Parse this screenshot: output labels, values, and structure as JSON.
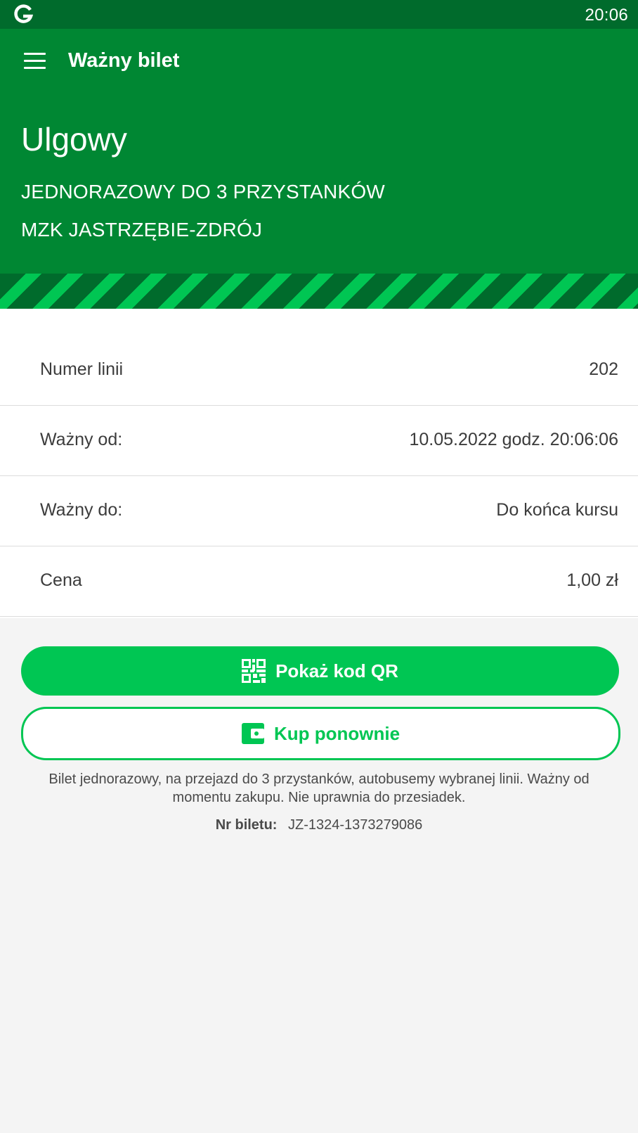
{
  "status_bar": {
    "app_icon": "google-g-icon",
    "time": "20:06"
  },
  "app_bar": {
    "menu_icon": "hamburger-menu-icon",
    "title": "Ważny bilet"
  },
  "ticket": {
    "type": "Ulgowy",
    "name": "JEDNORAZOWY DO 3 PRZYSTANKÓW",
    "operator": "MZK JASTRZĘBIE-ZDRÓJ"
  },
  "details": [
    {
      "label": "Numer linii",
      "value": "202"
    },
    {
      "label": "Ważny od:",
      "value": "10.05.2022 godz. 20:06:06"
    },
    {
      "label": "Ważny do:",
      "value": "Do końca kursu"
    },
    {
      "label": "Cena",
      "value": "1,00 zł"
    }
  ],
  "actions": {
    "show_qr": {
      "label": "Pokaż kod QR",
      "icon": "qr-code-icon"
    },
    "buy_again": {
      "label": "Kup ponownie",
      "icon": "wallet-icon"
    }
  },
  "description": "Bilet jednorazowy, na przejazd do 3 przystanków, autobusemy wybranej linii. Ważny od momentu zakupu. Nie uprawnia do przesiadek.",
  "ticket_number": {
    "label": "Nr biletu:",
    "value": "JZ-1324-1373279086"
  },
  "colors": {
    "status_bar": "#006b2c",
    "header": "#008733",
    "accent": "#00c653",
    "background": "#f4f4f4"
  }
}
